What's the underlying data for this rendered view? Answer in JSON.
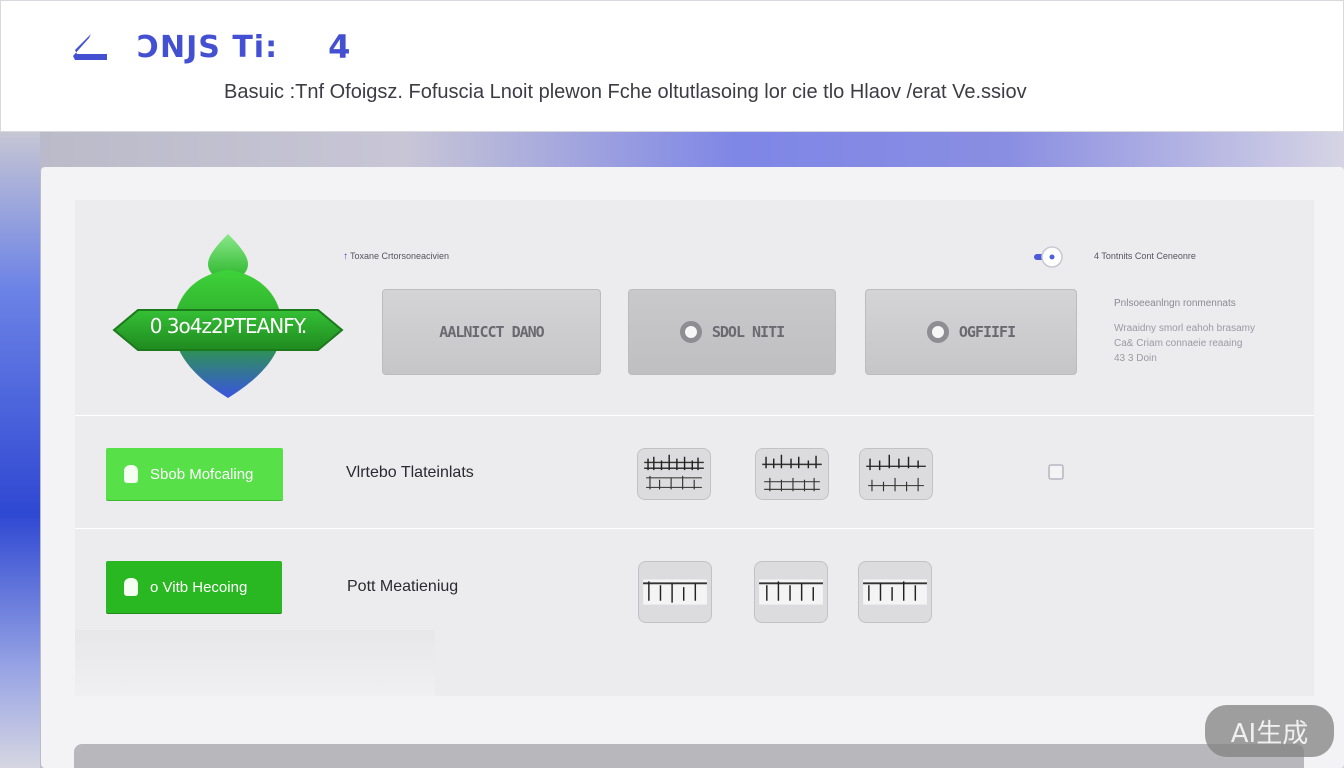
{
  "header": {
    "title": "ƆNJS Ti:",
    "title_number": "4",
    "subtitle": "Basuic :Tnf Ofoigsz. Fofuscia Lnoit plewon Fche oltutlasoing lor cie tlo Hlaov /erat Ve.ssiov"
  },
  "row1": {
    "logo_text": "0 3o4z2PTEANFY.",
    "label_left": "Toxane Crtorsoneacivien",
    "label_right": "4 Tontnits Cont Ceneonre",
    "cards": [
      {
        "label": "AALNICCT DANO",
        "has_dot": false
      },
      {
        "label": "SDOL NITI",
        "has_dot": true
      },
      {
        "label": "OGFIIFI",
        "has_dot": true
      }
    ],
    "side_title": "Pnlsoeeanlngn ronmennats",
    "side_lines": [
      "Wraaidny smorl eahoh brasamy",
      "Ca& Criam connaeie reaaing",
      "43 3 Doin"
    ]
  },
  "row2": {
    "button_label": "Sbob Mofcaling",
    "label": "Vlrtebo Tlateinlats"
  },
  "row3": {
    "button_label": "o Vitb Hecoing",
    "label": "Pott Meatieniug"
  },
  "watermark": "AI生成",
  "colors": {
    "accent": "#4450d2",
    "green_light": "#57e048",
    "green_dark": "#29b821",
    "blue": "#3a4fd6"
  },
  "icons": {
    "back": "back-arrow-icon",
    "toggle": "toggle-icon",
    "bell": "bell-icon"
  }
}
